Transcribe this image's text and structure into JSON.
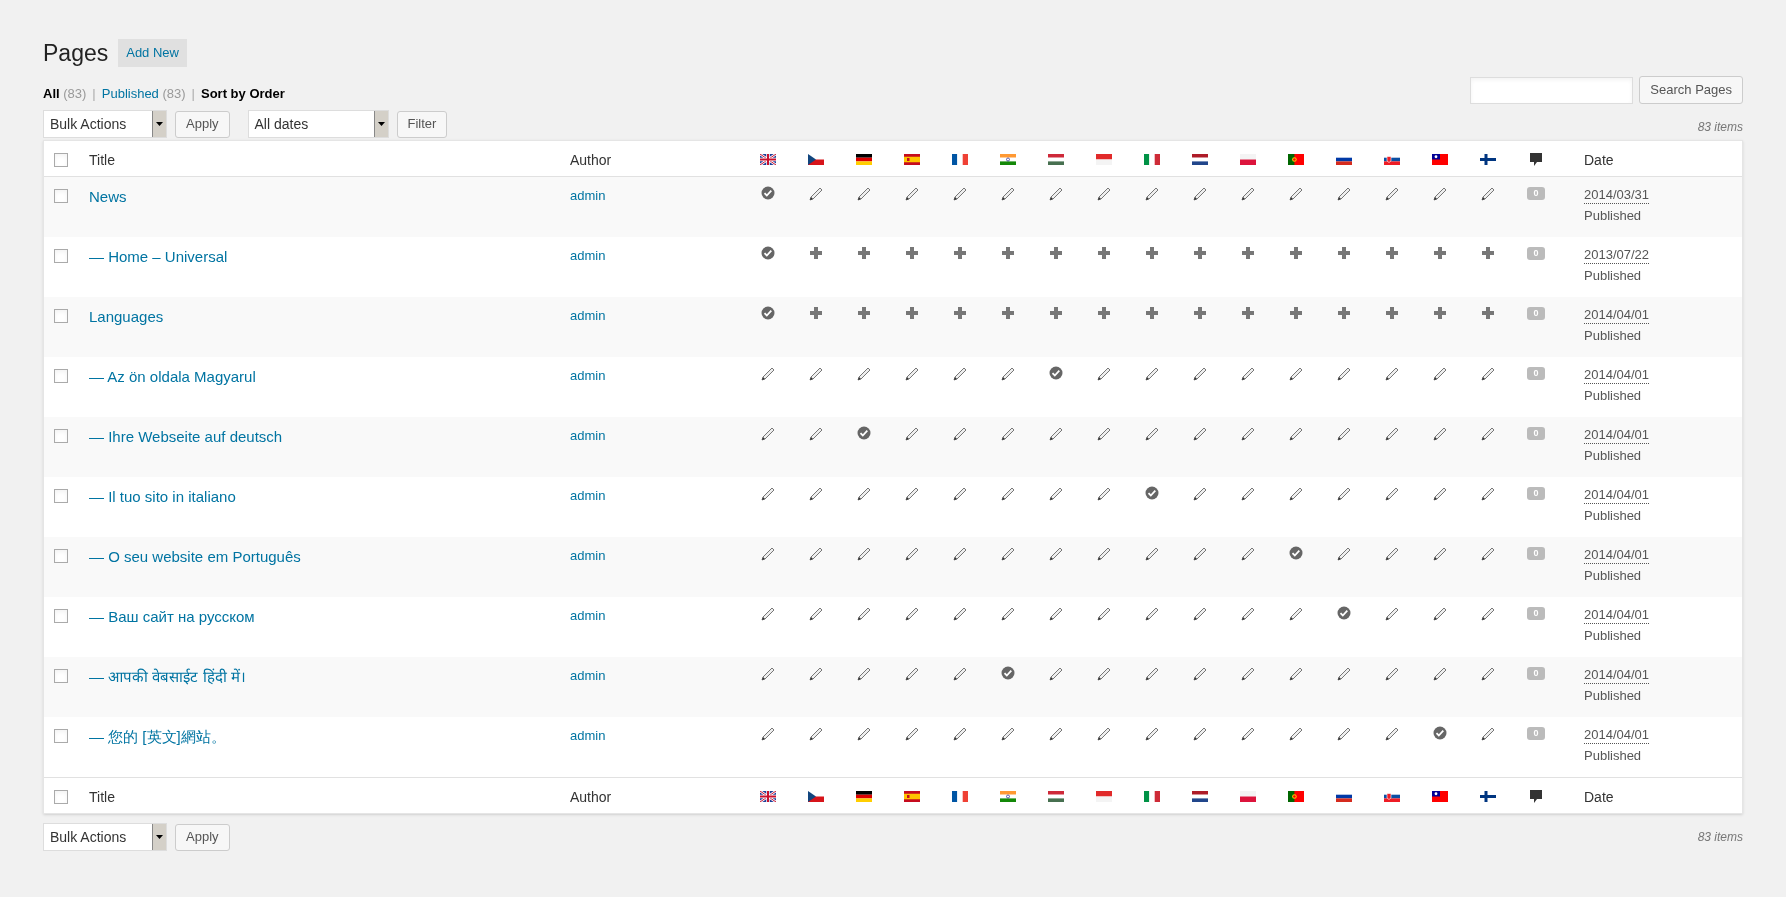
{
  "heading": {
    "title": "Pages",
    "add_new": "Add New"
  },
  "views": [
    {
      "label": "All",
      "count": "(83)",
      "selected": true
    },
    {
      "separator": "|",
      "label": "Published",
      "count": "(83)",
      "selected": false
    },
    {
      "separator": "|",
      "label": "Sort by Order",
      "selected": true
    }
  ],
  "search": {
    "button": "Search Pages"
  },
  "top_actions": {
    "bulk": "Bulk Actions",
    "apply": "Apply",
    "dates": "All dates",
    "filter": "Filter",
    "count": "83 items"
  },
  "header_columns": {
    "checked": false,
    "title": "Title",
    "author": "Author",
    "date": "Date",
    "languages": [
      {
        "kind": "gb"
      },
      {
        "kind": "cz"
      },
      {
        "kind": "de"
      },
      {
        "kind": "es"
      },
      {
        "kind": "fr"
      },
      {
        "kind": "in"
      },
      {
        "kind": "hu"
      },
      {
        "kind": "id"
      },
      {
        "kind": "it"
      },
      {
        "kind": "nl"
      },
      {
        "kind": "pl"
      },
      {
        "kind": "pt"
      },
      {
        "kind": "ru"
      },
      {
        "kind": "sk"
      },
      {
        "kind": "tw"
      },
      {
        "kind": "fi"
      }
    ]
  },
  "rows": [
    {
      "checked": false,
      "title": "News",
      "author": "admin",
      "translations": [
        {
          "kind": "done"
        },
        {
          "kind": "edit"
        },
        {
          "kind": "edit"
        },
        {
          "kind": "edit"
        },
        {
          "kind": "edit"
        },
        {
          "kind": "edit"
        },
        {
          "kind": "edit"
        },
        {
          "kind": "edit"
        },
        {
          "kind": "edit"
        },
        {
          "kind": "edit"
        },
        {
          "kind": "edit"
        },
        {
          "kind": "edit"
        },
        {
          "kind": "edit"
        },
        {
          "kind": "edit"
        },
        {
          "kind": "edit"
        },
        {
          "kind": "edit"
        }
      ],
      "comments": "0",
      "date": "2014/03/31",
      "status": "Published"
    },
    {
      "checked": false,
      "title": "— Home – Universal",
      "author": "admin",
      "translations": [
        {
          "kind": "done"
        },
        {
          "kind": "add"
        },
        {
          "kind": "add"
        },
        {
          "kind": "add"
        },
        {
          "kind": "add"
        },
        {
          "kind": "add"
        },
        {
          "kind": "add"
        },
        {
          "kind": "add"
        },
        {
          "kind": "add"
        },
        {
          "kind": "add"
        },
        {
          "kind": "add"
        },
        {
          "kind": "add"
        },
        {
          "kind": "add"
        },
        {
          "kind": "add"
        },
        {
          "kind": "add"
        },
        {
          "kind": "add"
        }
      ],
      "comments": "0",
      "date": "2013/07/22",
      "status": "Published"
    },
    {
      "checked": false,
      "title": "Languages",
      "author": "admin",
      "translations": [
        {
          "kind": "done"
        },
        {
          "kind": "add"
        },
        {
          "kind": "add"
        },
        {
          "kind": "add"
        },
        {
          "kind": "add"
        },
        {
          "kind": "add"
        },
        {
          "kind": "add"
        },
        {
          "kind": "add"
        },
        {
          "kind": "add"
        },
        {
          "kind": "add"
        },
        {
          "kind": "add"
        },
        {
          "kind": "add"
        },
        {
          "kind": "add"
        },
        {
          "kind": "add"
        },
        {
          "kind": "add"
        },
        {
          "kind": "add"
        }
      ],
      "comments": "0",
      "date": "2014/04/01",
      "status": "Published"
    },
    {
      "checked": false,
      "title": "— Az ön oldala Magyarul",
      "author": "admin",
      "translations": [
        {
          "kind": "edit"
        },
        {
          "kind": "edit"
        },
        {
          "kind": "edit"
        },
        {
          "kind": "edit"
        },
        {
          "kind": "edit"
        },
        {
          "kind": "edit"
        },
        {
          "kind": "done"
        },
        {
          "kind": "edit"
        },
        {
          "kind": "edit"
        },
        {
          "kind": "edit"
        },
        {
          "kind": "edit"
        },
        {
          "kind": "edit"
        },
        {
          "kind": "edit"
        },
        {
          "kind": "edit"
        },
        {
          "kind": "edit"
        },
        {
          "kind": "edit"
        }
      ],
      "comments": "0",
      "date": "2014/04/01",
      "status": "Published"
    },
    {
      "checked": false,
      "title": "— Ihre Webseite auf deutsch",
      "author": "admin",
      "translations": [
        {
          "kind": "edit"
        },
        {
          "kind": "edit"
        },
        {
          "kind": "done"
        },
        {
          "kind": "edit"
        },
        {
          "kind": "edit"
        },
        {
          "kind": "edit"
        },
        {
          "kind": "edit"
        },
        {
          "kind": "edit"
        },
        {
          "kind": "edit"
        },
        {
          "kind": "edit"
        },
        {
          "kind": "edit"
        },
        {
          "kind": "edit"
        },
        {
          "kind": "edit"
        },
        {
          "kind": "edit"
        },
        {
          "kind": "edit"
        },
        {
          "kind": "edit"
        }
      ],
      "comments": "0",
      "date": "2014/04/01",
      "status": "Published"
    },
    {
      "checked": false,
      "title": "— Il tuo sito in italiano",
      "author": "admin",
      "translations": [
        {
          "kind": "edit"
        },
        {
          "kind": "edit"
        },
        {
          "kind": "edit"
        },
        {
          "kind": "edit"
        },
        {
          "kind": "edit"
        },
        {
          "kind": "edit"
        },
        {
          "kind": "edit"
        },
        {
          "kind": "edit"
        },
        {
          "kind": "done"
        },
        {
          "kind": "edit"
        },
        {
          "kind": "edit"
        },
        {
          "kind": "edit"
        },
        {
          "kind": "edit"
        },
        {
          "kind": "edit"
        },
        {
          "kind": "edit"
        },
        {
          "kind": "edit"
        }
      ],
      "comments": "0",
      "date": "2014/04/01",
      "status": "Published"
    },
    {
      "checked": false,
      "title": "— O seu website em Português",
      "author": "admin",
      "translations": [
        {
          "kind": "edit"
        },
        {
          "kind": "edit"
        },
        {
          "kind": "edit"
        },
        {
          "kind": "edit"
        },
        {
          "kind": "edit"
        },
        {
          "kind": "edit"
        },
        {
          "kind": "edit"
        },
        {
          "kind": "edit"
        },
        {
          "kind": "edit"
        },
        {
          "kind": "edit"
        },
        {
          "kind": "edit"
        },
        {
          "kind": "done"
        },
        {
          "kind": "edit"
        },
        {
          "kind": "edit"
        },
        {
          "kind": "edit"
        },
        {
          "kind": "edit"
        }
      ],
      "comments": "0",
      "date": "2014/04/01",
      "status": "Published"
    },
    {
      "checked": false,
      "title": "— Ваш сайт на русском",
      "author": "admin",
      "translations": [
        {
          "kind": "edit"
        },
        {
          "kind": "edit"
        },
        {
          "kind": "edit"
        },
        {
          "kind": "edit"
        },
        {
          "kind": "edit"
        },
        {
          "kind": "edit"
        },
        {
          "kind": "edit"
        },
        {
          "kind": "edit"
        },
        {
          "kind": "edit"
        },
        {
          "kind": "edit"
        },
        {
          "kind": "edit"
        },
        {
          "kind": "edit"
        },
        {
          "kind": "done"
        },
        {
          "kind": "edit"
        },
        {
          "kind": "edit"
        },
        {
          "kind": "edit"
        }
      ],
      "comments": "0",
      "date": "2014/04/01",
      "status": "Published"
    },
    {
      "checked": false,
      "title": "— आपकी वेबसाईट हिंदी में।",
      "author": "admin",
      "translations": [
        {
          "kind": "edit"
        },
        {
          "kind": "edit"
        },
        {
          "kind": "edit"
        },
        {
          "kind": "edit"
        },
        {
          "kind": "edit"
        },
        {
          "kind": "done"
        },
        {
          "kind": "edit"
        },
        {
          "kind": "edit"
        },
        {
          "kind": "edit"
        },
        {
          "kind": "edit"
        },
        {
          "kind": "edit"
        },
        {
          "kind": "edit"
        },
        {
          "kind": "edit"
        },
        {
          "kind": "edit"
        },
        {
          "kind": "edit"
        },
        {
          "kind": "edit"
        }
      ],
      "comments": "0",
      "date": "2014/04/01",
      "status": "Published"
    },
    {
      "checked": false,
      "title": "— 您的 [英文]網站。",
      "author": "admin",
      "translations": [
        {
          "kind": "edit"
        },
        {
          "kind": "edit"
        },
        {
          "kind": "edit"
        },
        {
          "kind": "edit"
        },
        {
          "kind": "edit"
        },
        {
          "kind": "edit"
        },
        {
          "kind": "edit"
        },
        {
          "kind": "edit"
        },
        {
          "kind": "edit"
        },
        {
          "kind": "edit"
        },
        {
          "kind": "edit"
        },
        {
          "kind": "edit"
        },
        {
          "kind": "edit"
        },
        {
          "kind": "edit"
        },
        {
          "kind": "done"
        },
        {
          "kind": "edit"
        }
      ],
      "comments": "0",
      "date": "2014/04/01",
      "status": "Published"
    }
  ],
  "footer_columns": {
    "checked": false,
    "title": "Title",
    "author": "Author",
    "date": "Date",
    "languages": [
      {
        "kind": "gb"
      },
      {
        "kind": "cz"
      },
      {
        "kind": "de"
      },
      {
        "kind": "es"
      },
      {
        "kind": "fr"
      },
      {
        "kind": "in"
      },
      {
        "kind": "hu"
      },
      {
        "kind": "id"
      },
      {
        "kind": "it"
      },
      {
        "kind": "nl"
      },
      {
        "kind": "pl"
      },
      {
        "kind": "pt"
      },
      {
        "kind": "ru"
      },
      {
        "kind": "sk"
      },
      {
        "kind": "tw"
      },
      {
        "kind": "fi"
      }
    ]
  },
  "bottom_actions": {
    "bulk": "Bulk Actions",
    "apply": "Apply",
    "count": "83 items"
  }
}
